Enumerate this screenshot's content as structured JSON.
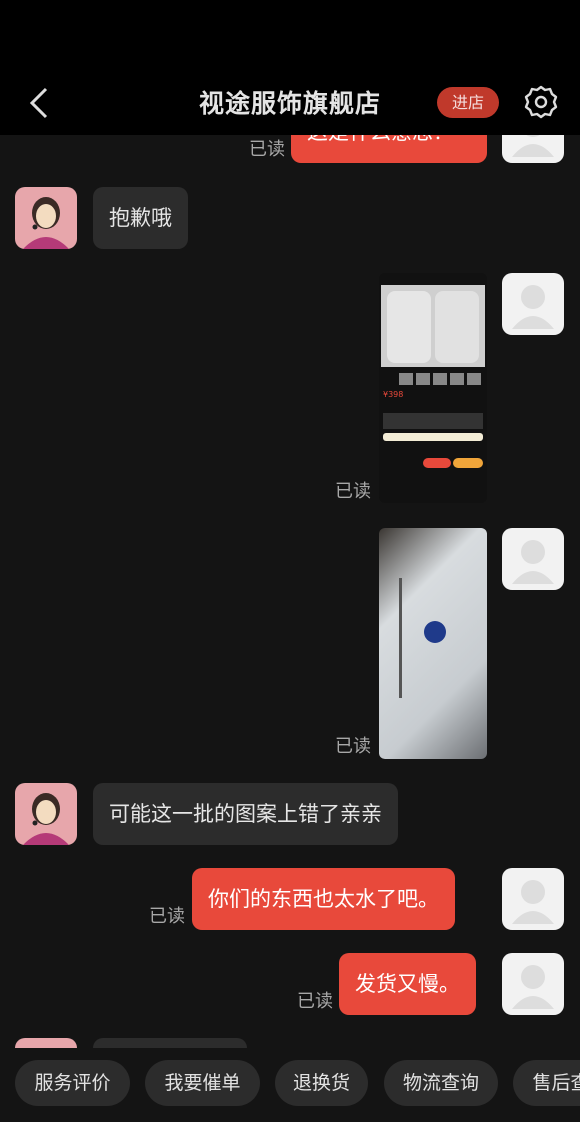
{
  "header": {
    "title": "视途服饰旗舰店",
    "enter_store": "进店",
    "back_icon": "chevron-left-icon",
    "settings_icon": "gear-icon"
  },
  "colors": {
    "accent": "#e8493b",
    "enter_button": "#c0392b",
    "background": "#141414"
  },
  "messages": [
    {
      "side": "out",
      "text": "这是什么意思？",
      "status": "已读"
    },
    {
      "side": "in",
      "text": "抱歉哦"
    },
    {
      "side": "out",
      "type": "image",
      "description_text": "¥398",
      "status": "已读"
    },
    {
      "side": "out",
      "type": "image",
      "status": "已读"
    },
    {
      "side": "in",
      "text": "可能这一批的图案上错了亲亲"
    },
    {
      "side": "out",
      "text": "你们的东西也太水了吧。",
      "status": "已读"
    },
    {
      "side": "out",
      "text": "发货又慢。",
      "status": "已读"
    }
  ],
  "quick_replies": [
    "服务评价",
    "我要催单",
    "退换货",
    "物流查询",
    "售后查询"
  ]
}
